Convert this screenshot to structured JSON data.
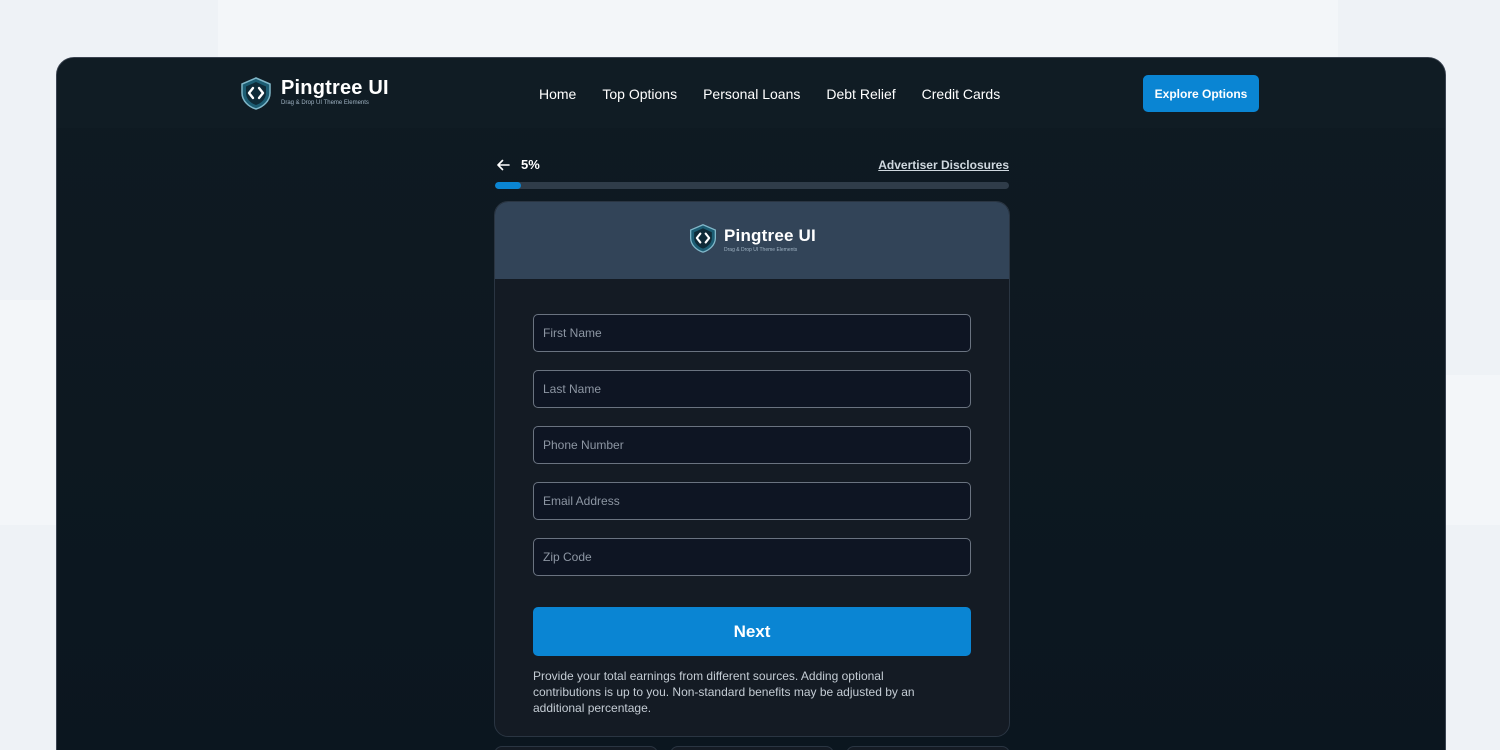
{
  "brand": {
    "name": "Pingtree UI",
    "tagline": "Drag & Drop UI Theme Elements"
  },
  "nav": {
    "links": [
      "Home",
      "Top Options",
      "Personal Loans",
      "Debt Relief",
      "Credit Cards"
    ],
    "cta_label": "Explore Options"
  },
  "progress": {
    "percent_label": "5%",
    "value": 0.05,
    "disclosures_label": "Advertiser Disclosures"
  },
  "form": {
    "fields": [
      {
        "placeholder": "First Name",
        "value": ""
      },
      {
        "placeholder": "Last Name",
        "value": ""
      },
      {
        "placeholder": "Phone Number",
        "value": ""
      },
      {
        "placeholder": "Email Address",
        "value": ""
      },
      {
        "placeholder": "Zip Code",
        "value": ""
      }
    ],
    "submit_label": "Next",
    "note": "Provide your total earnings from different sources. Adding optional contributions is up to you. Non-standard benefits may be adjusted by an additional percentage."
  },
  "colors": {
    "accent": "#0a85d3",
    "frame_bg": "#0f1a22",
    "card_bg": "#141b24",
    "card_header_bg": "#324458"
  },
  "icons": {
    "logo": "shield-code-icon",
    "back": "arrow-left-icon"
  }
}
